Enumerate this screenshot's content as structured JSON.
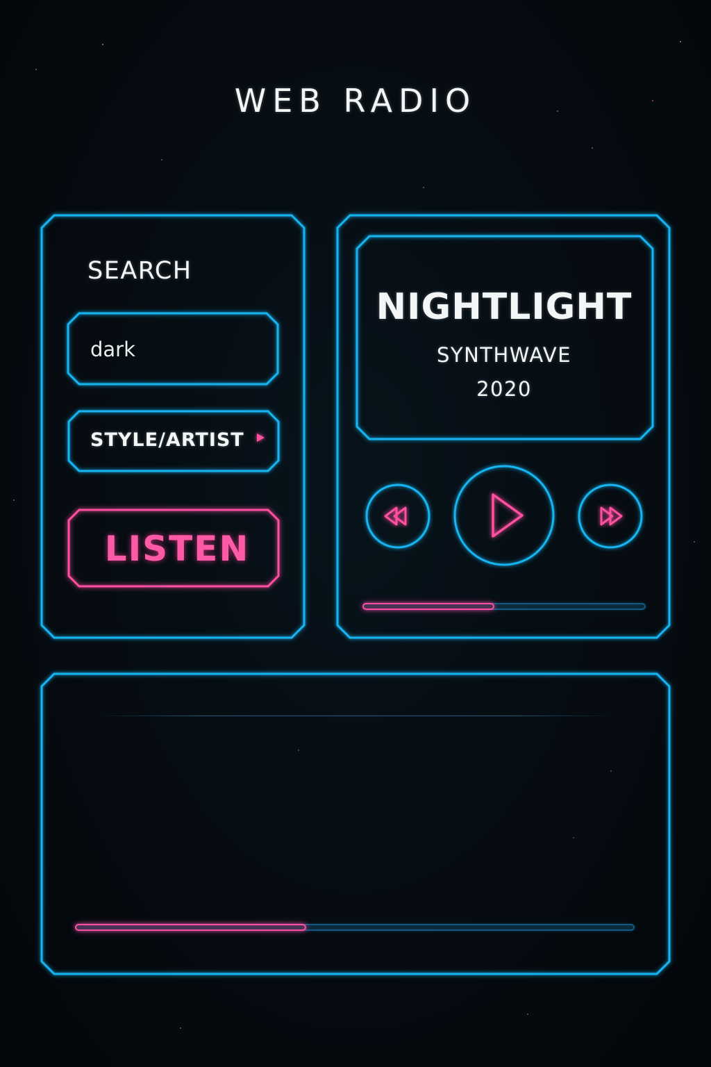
{
  "app": {
    "title": "WEB RADIO"
  },
  "search": {
    "label": "SEARCH",
    "input_value": "dark",
    "style_artist_label": "STYLE/ARTIST",
    "listen_label": "LISTEN"
  },
  "player": {
    "track_title": "NIGHTLIGHT",
    "genre": "SYNTHWAVE",
    "year": "2020",
    "progress": 0.47,
    "controls": {
      "rewind_icon": "rewind-icon",
      "play_icon": "play-icon",
      "fast_forward_icon": "fast-forward-icon"
    }
  },
  "lower_panel": {
    "progress": 0.415
  },
  "colors": {
    "frame_cyan": "#18b4f0",
    "accent_pink": "#ff4fa0",
    "background": "#050b10",
    "text": "#f3f6f6"
  }
}
